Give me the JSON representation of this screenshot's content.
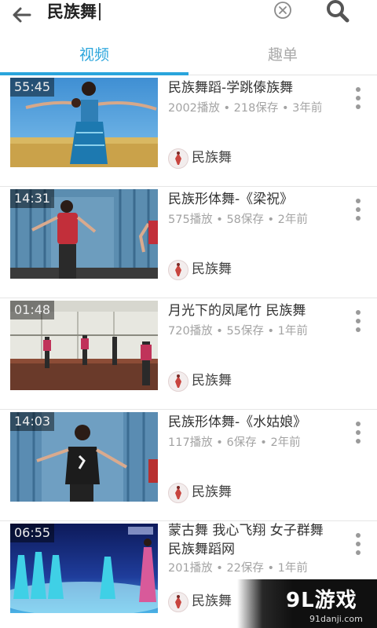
{
  "search": {
    "query": "民族舞"
  },
  "tabs": [
    {
      "label": "视频",
      "active": true
    },
    {
      "label": "趣单",
      "active": false
    }
  ],
  "colors": {
    "accent": "#2aa5dc",
    "inactive_tab": "#a9a9a9",
    "meta": "#a3a3a3"
  },
  "videos": [
    {
      "duration": "55:45",
      "title": "民族舞蹈-学跳傣族舞",
      "stats": "2002播放 • 218保存 • 3年前",
      "channel": "民族舞"
    },
    {
      "duration": "14:31",
      "title": "民族形体舞-《梁祝》",
      "stats": "575播放 • 58保存 • 2年前",
      "channel": "民族舞"
    },
    {
      "duration": "01:48",
      "title": "月光下的凤尾竹 民族舞",
      "stats": "720播放 • 55保存 • 1年前",
      "channel": "民族舞"
    },
    {
      "duration": "14:03",
      "title": "民族形体舞-《水姑娘》",
      "stats": "117播放 • 6保存 • 2年前",
      "channel": "民族舞"
    },
    {
      "duration": "06:55",
      "title": "蒙古舞 我心飞翔 女子群舞 民族舞蹈网",
      "stats": "201播放 • 22保存 • 1年前",
      "channel": "民族舞"
    }
  ],
  "watermark": {
    "logo": "9L游戏",
    "site": "91danji.com"
  },
  "icons": {
    "back": "back-arrow-icon",
    "clear": "clear-icon",
    "search": "search-icon",
    "more": "more-vertical-icon"
  }
}
